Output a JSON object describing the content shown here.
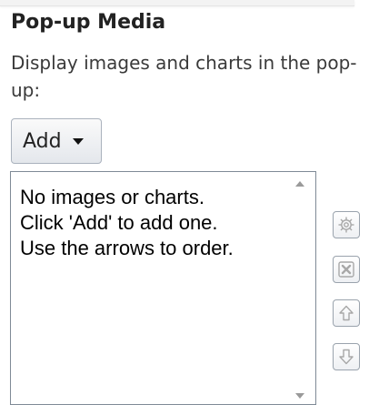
{
  "panel": {
    "title": "Pop-up Media",
    "description": "Display images and charts in the pop-up:"
  },
  "add_menu": {
    "label": "Add"
  },
  "media_list": {
    "empty_lines": [
      "No images or charts.",
      "Click 'Add' to add one.",
      "Use the arrows to order."
    ]
  },
  "tools": [
    {
      "name": "settings",
      "icon": "gear-icon"
    },
    {
      "name": "delete",
      "icon": "delete-icon"
    },
    {
      "name": "move-up",
      "icon": "arrow-up-icon"
    },
    {
      "name": "move-down",
      "icon": "arrow-down-icon"
    }
  ],
  "colors": {
    "icon_disabled": "#a8a8a8",
    "list_border": "#7f8a96"
  }
}
